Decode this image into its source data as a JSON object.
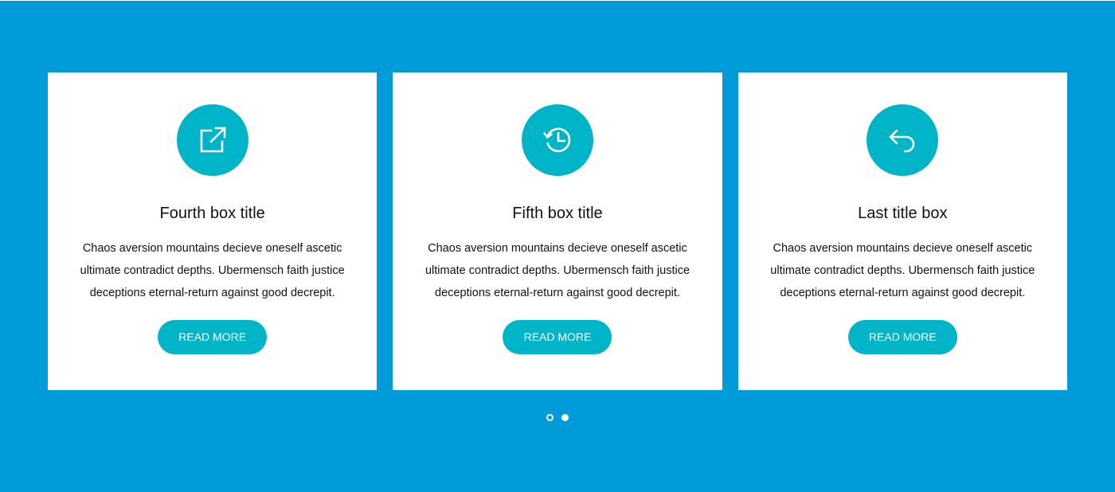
{
  "colors": {
    "background": "#009bd8",
    "card_background": "#ffffff",
    "accent": "#00b4c8",
    "text": "#111111"
  },
  "cards": [
    {
      "icon": "external-link-icon",
      "title": "Fourth box title",
      "text": "Chaos aversion mountains decieve oneself ascetic ultimate contradict depths. Ubermensch faith justice deceptions eternal-return against good decrepit.",
      "button_label": "READ MORE"
    },
    {
      "icon": "history-icon",
      "title": "Fifth box title",
      "text": "Chaos aversion mountains decieve oneself ascetic ultimate contradict depths. Ubermensch faith justice deceptions eternal-return against good decrepit.",
      "button_label": "READ MORE"
    },
    {
      "icon": "reply-icon",
      "title": "Last title box",
      "text": "Chaos aversion mountains decieve oneself ascetic ultimate contradict depths. Ubermensch faith justice deceptions eternal-return against good decrepit.",
      "button_label": "READ MORE"
    }
  ],
  "pagination": {
    "total": 2,
    "active_index": 1
  }
}
